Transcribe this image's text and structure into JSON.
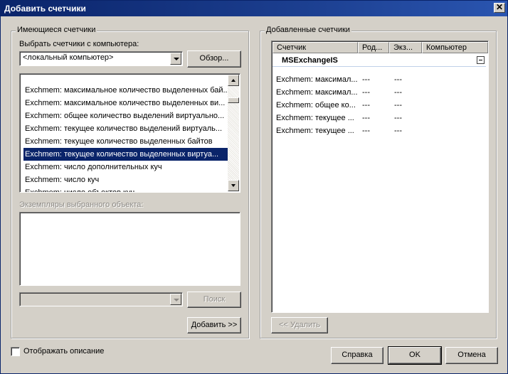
{
  "window": {
    "title": "Добавить счетчики",
    "close_glyph": "✕"
  },
  "available": {
    "group_title": "Имеющиеся счетчики",
    "select_label": "Выбрать счетчики с компьютера:",
    "computer_value": "<локальный компьютер>",
    "browse_label": "Обзор...",
    "counters": [
      "Exchmem: максимальное количество выделенных бай...",
      "Exchmem: максимальное количество выделенных ви...",
      "Exchmem: общее количество выделений виртуально...",
      "Exchmem: текущее количество выделений виртуаль...",
      "Exchmem: текущее количество выделенных байтов",
      "Exchmem: текущее количество выделенных виртуа...",
      "Exchmem: число дополнительных куч",
      "Exchmem: число куч",
      "Exchmem: число объектов куч"
    ],
    "selected_index": 5,
    "instances_label": "Экземпляры выбранного объекта:",
    "search_label": "Поиск",
    "add_label": "Добавить >>"
  },
  "added": {
    "group_title": "Добавленные счетчики",
    "columns": [
      "Счетчик",
      "Род...",
      "Экз...",
      "Компьютер"
    ],
    "object_name": "MSExchangeIS",
    "rows": [
      {
        "counter": "Exchmem: максимал...",
        "parent": "---",
        "instance": "---"
      },
      {
        "counter": "Exchmem: максимал...",
        "parent": "---",
        "instance": "---"
      },
      {
        "counter": "Exchmem: общее ко...",
        "parent": "---",
        "instance": "---"
      },
      {
        "counter": "Exchmem: текущее ...",
        "parent": "---",
        "instance": "---"
      },
      {
        "counter": "Exchmem: текущее ...",
        "parent": "---",
        "instance": "---"
      }
    ],
    "remove_label": "<< Удалить"
  },
  "footer": {
    "show_description_label": "Отображать описание",
    "help_label": "Справка",
    "ok_label": "OK",
    "cancel_label": "Отмена"
  }
}
